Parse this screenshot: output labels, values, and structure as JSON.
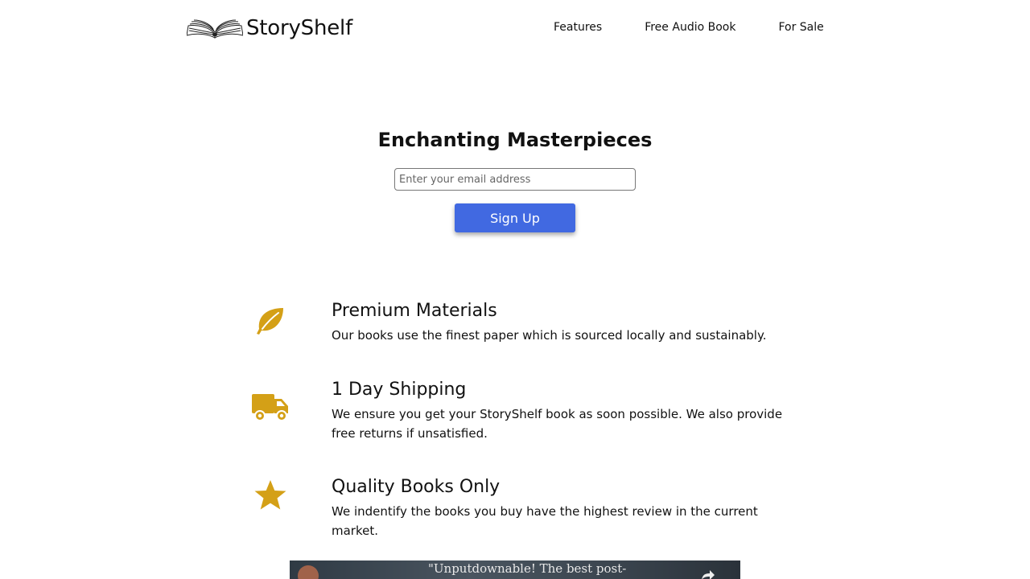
{
  "header": {
    "brand": "StoryShelf",
    "logo_icon": "open-book-icon",
    "nav": [
      "Features",
      "Free Audio Book",
      "For Sale"
    ]
  },
  "hero": {
    "title": "Enchanting Masterpieces",
    "email_placeholder": "Enter your email address",
    "signup_label": "Sign Up",
    "button_color": "#4169e1"
  },
  "features": [
    {
      "icon": "leaf-icon",
      "title": "Premium Materials",
      "description": "Our books use the finest paper which is sourced locally and sustainably."
    },
    {
      "icon": "truck-icon",
      "title": "1 Day Shipping",
      "description": "We ensure you get your StoryShelf book as soon possible. We also provide free returns if unsatisfied."
    },
    {
      "icon": "star-icon",
      "title": "Quality Books Only",
      "description": "We indentify the books you buy have the highest review in the current market."
    }
  ],
  "icon_color": "#d4a017",
  "video": {
    "quote": "\"Unputdownable! The best post-"
  }
}
